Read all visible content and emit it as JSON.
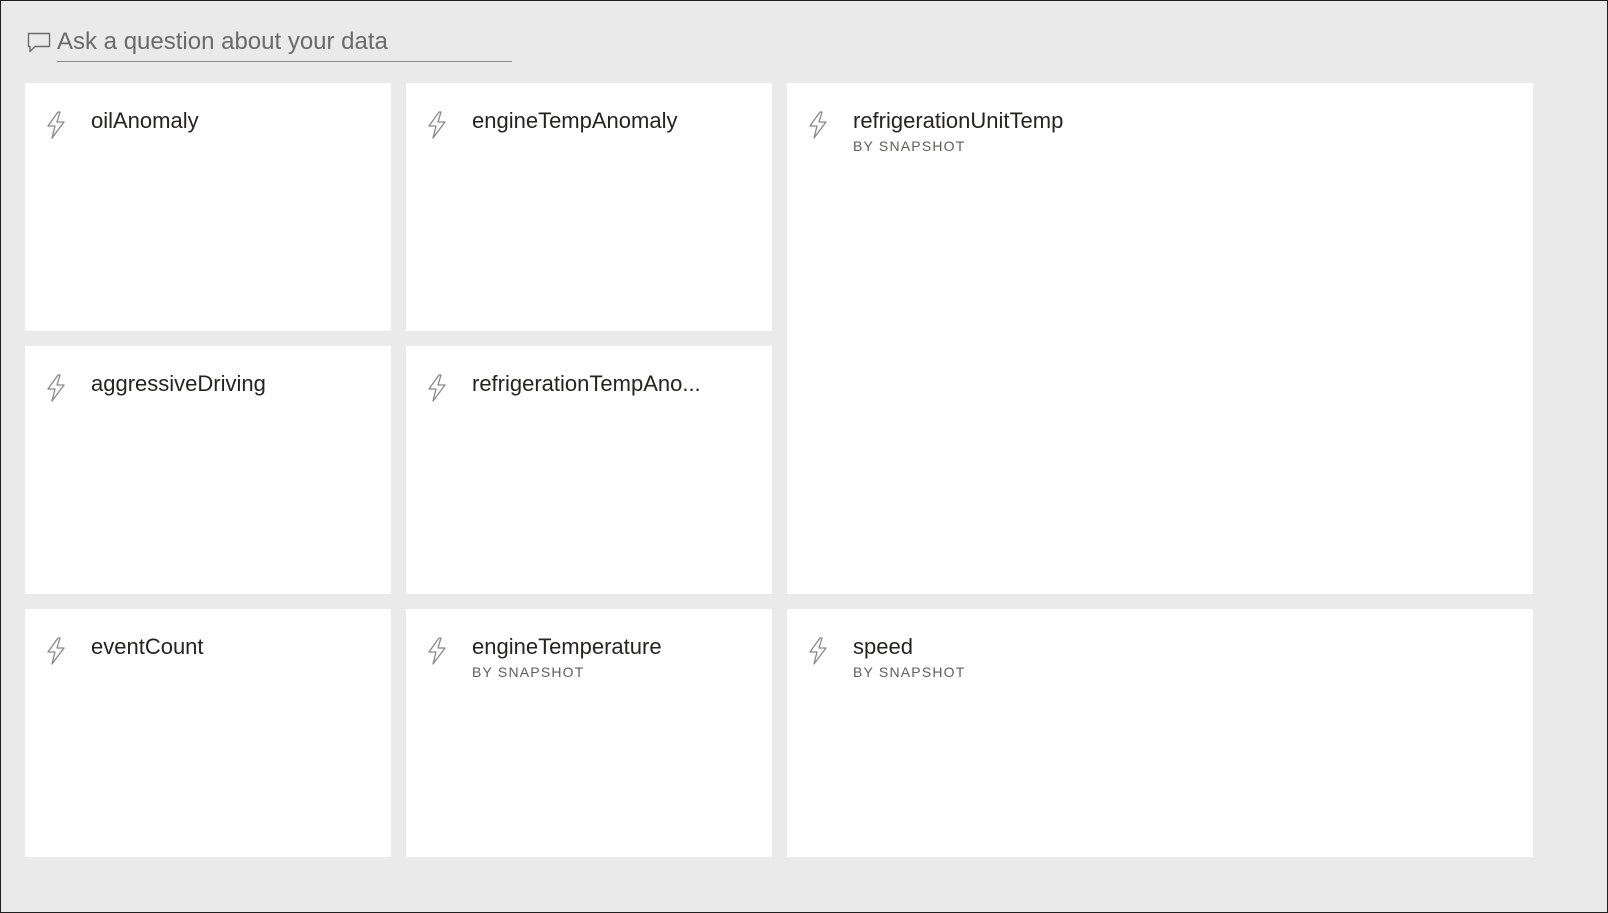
{
  "qna": {
    "placeholder": "Ask a question about your data",
    "icon": "chat-bubble-icon"
  },
  "tiles": [
    {
      "id": "oil-anomaly",
      "title": "oilAnomaly",
      "subtitle": "",
      "icon": "lightning-icon"
    },
    {
      "id": "engine-temp-anomaly",
      "title": "engineTempAnomaly",
      "subtitle": "",
      "icon": "lightning-icon"
    },
    {
      "id": "refrigeration-unit-temp",
      "title": "refrigerationUnitTemp",
      "subtitle": "BY SNAPSHOT",
      "icon": "lightning-icon"
    },
    {
      "id": "aggressive-driving",
      "title": "aggressiveDriving",
      "subtitle": "",
      "icon": "lightning-icon"
    },
    {
      "id": "refrigeration-temp-anomaly",
      "title": "refrigerationTempAno...",
      "subtitle": "",
      "icon": "lightning-icon"
    },
    {
      "id": "event-count",
      "title": "eventCount",
      "subtitle": "",
      "icon": "lightning-icon"
    },
    {
      "id": "engine-temperature",
      "title": "engineTemperature",
      "subtitle": "BY SNAPSHOT",
      "icon": "lightning-icon"
    },
    {
      "id": "speed",
      "title": "speed",
      "subtitle": "BY SNAPSHOT",
      "icon": "lightning-icon"
    }
  ],
  "colors": {
    "canvas": "#eaeaea",
    "tile": "#ffffff",
    "title": "#252423",
    "subtitle": "#605e5c",
    "icon": "#8a8886"
  }
}
